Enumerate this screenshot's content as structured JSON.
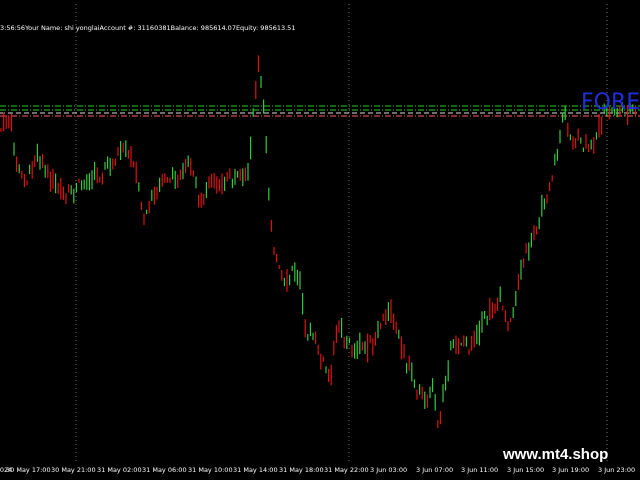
{
  "header": {
    "time": "3:56:56",
    "name_label": "Your Name",
    "name_value": ": shi yonglai",
    "account_label": "Account #",
    "account_value": ": 31160381",
    "balance_label": "Balance",
    "balance_value": ": 985614.07",
    "equity_label": "Equity",
    "equity_value": ": 985613.51"
  },
  "watermark": {
    "logo_text": "FORE",
    "site": "www.mt4.shop"
  },
  "time_axis": {
    "labels": [
      "0 May 2024",
      "30 May 17:00",
      "30 May 21:00",
      "31 May 02:00",
      "31 May 06:00",
      "31 May 10:00",
      "31 May 14:00",
      "31 May 18:00",
      "31 May 22:00",
      "3 Jun 03:00",
      "3 Jun 07:00",
      "3 Jun 11:00",
      "3 Jun 15:00",
      "3 Jun 19:00",
      "3 Jun 23:00"
    ]
  },
  "colors": {
    "background": "#000000",
    "bull": "#2ecc40",
    "bear": "#e01010",
    "grid": "#ffffff",
    "level_green": "#22cc22",
    "level_red": "#ff6060",
    "level_white": "#dddddd",
    "logo": "#1f2fd8"
  },
  "icons": {
    "grid": "dotted-vertical-grid-lines"
  }
}
